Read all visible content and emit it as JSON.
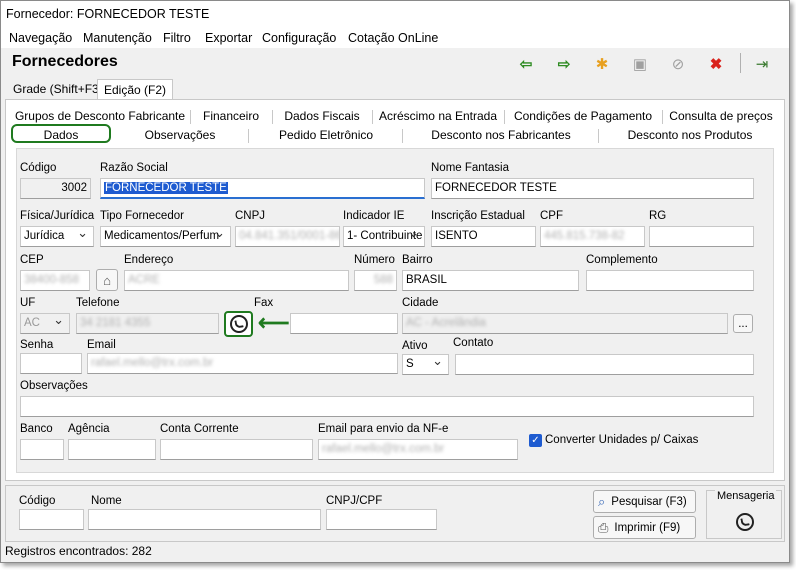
{
  "window": {
    "title": "Fornecedor: FORNECEDOR TESTE"
  },
  "menu": [
    "Navegação",
    "Manutenção",
    "Filtro",
    "Exportar",
    "Configuração",
    "Cotação OnLine"
  ],
  "header": {
    "title": "Fornecedores"
  },
  "toolbar": {
    "icons": [
      "arrow-left-icon",
      "arrow-right-icon",
      "new-icon",
      "save-icon",
      "cancel-icon",
      "delete-icon",
      "exit-icon"
    ],
    "colors": {
      "arrows": "#2e8b22",
      "delete": "#d9231d"
    }
  },
  "page_tabs": [
    "Grade (Shift+F3)",
    "Edição (F2)"
  ],
  "sub_tabs_row1": [
    "Grupos de Desconto Fabricante",
    "Financeiro",
    "Dados Fiscais",
    "Acréscimo na Entrada",
    "Condições de Pagamento",
    "Consulta de preços"
  ],
  "sub_tabs_row2": [
    "Dados",
    "Observações",
    "Pedido Eletrônico",
    "Desconto nos Fabricantes",
    "Desconto nos Produtos"
  ],
  "form": {
    "codigo_label": "Código",
    "codigo_value": "3002",
    "razao_label": "Razão Social",
    "razao_value": "FORNECEDOR TESTE",
    "fantasia_label": "Nome Fantasia",
    "fantasia_value": "FORNECEDOR TESTE",
    "fisica_label": "Física/Jurídica",
    "fisica_value": "Jurídica",
    "tipo_label": "Tipo Fornecedor",
    "tipo_value": "Medicamentos/Perfum",
    "cnpj_label": "CNPJ",
    "cnpj_value": "04.841.351/0001-86",
    "indicador_label": "Indicador IE",
    "indicador_value": "1- Contribuinte",
    "ie_label": "Inscrição Estadual",
    "ie_value": "ISENTO",
    "cpf_label": "CPF",
    "cpf_value": "445.815.738-82",
    "rg_label": "RG",
    "cep_label": "CEP",
    "cep_value": "38400-858",
    "endereco_label": "Endereço",
    "endereco_value": "ACRE",
    "numero_label": "Número",
    "numero_value": "588",
    "bairro_label": "Bairro",
    "bairro_value": "BRASIL",
    "complemento_label": "Complemento",
    "uf_label": "UF",
    "uf_value": "AC",
    "telefone_label": "Telefone",
    "telefone_value": "34 2181 4355",
    "fax_label": "Fax",
    "cidade_label": "Cidade",
    "cidade_value": "AC - Acrelândia",
    "cidade_button": "...",
    "senha_label": "Senha",
    "email_label": "Email",
    "email_value": "rafael.mello@trx.com.br",
    "ativo_label": "Ativo",
    "ativo_value": "S",
    "contato_label": "Contato",
    "observacoes_label": "Observações",
    "banco_label": "Banco",
    "agencia_label": "Agência",
    "conta_label": "Conta Corrente",
    "email_nfe_label": "Email para envio da NF-e",
    "email_nfe_value": "rafael.mello@trx.com.br",
    "converter_label": "Converter Unidades p/ Caixas",
    "converter_checked": true
  },
  "search": {
    "codigo_label": "Código",
    "nome_label": "Nome",
    "cnpj_label": "CNPJ/CPF",
    "pesquisar_label": "Pesquisar (F3)",
    "imprimir_label": "Imprimir (F9)",
    "mensageria_label": "Mensageria"
  },
  "status": {
    "text": "Registros encontrados: 282"
  },
  "annotation": {
    "highlight_color": "#1f7a1f"
  }
}
